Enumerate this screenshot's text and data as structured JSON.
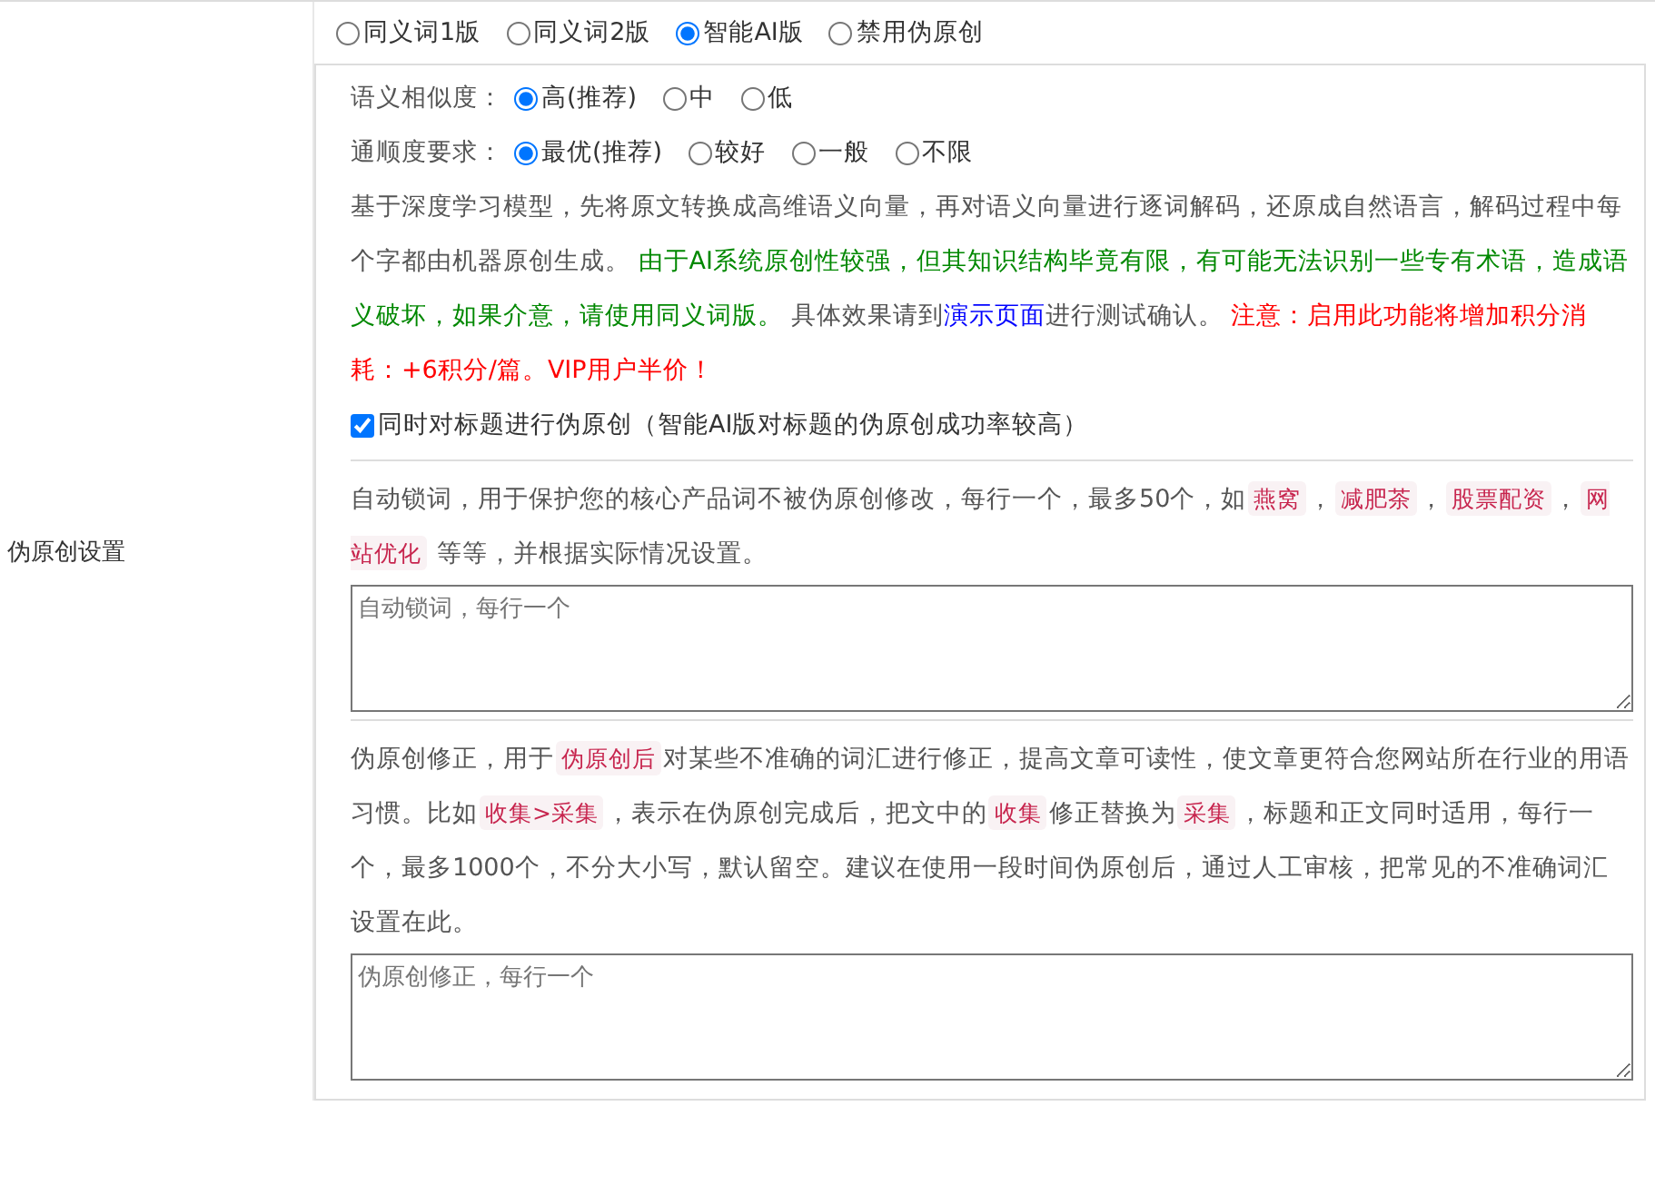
{
  "side_label": "伪原创设置",
  "modes": [
    {
      "label": "同义词1版",
      "selected": false
    },
    {
      "label": "同义词2版",
      "selected": false
    },
    {
      "label": "智能AI版",
      "selected": true
    },
    {
      "label": "禁用伪原创",
      "selected": false
    }
  ],
  "settings": [
    {
      "label": "语义相似度：",
      "options": [
        {
          "label": "高(推荐)",
          "selected": true
        },
        {
          "label": "中",
          "selected": false
        },
        {
          "label": "低",
          "selected": false
        }
      ]
    },
    {
      "label": "通顺度要求：",
      "options": [
        {
          "label": "最优(推荐)",
          "selected": true
        },
        {
          "label": "较好",
          "selected": false
        },
        {
          "label": "一般",
          "selected": false
        },
        {
          "label": "不限",
          "selected": false
        }
      ]
    }
  ],
  "ai_description": [
    {
      "kind": "text",
      "text": "基于深度学习模型，先将原文转换成高维语义向量，再对语义向量进行逐词解码，还原成自然语言，解码过程中每个字都由机器原创生成。 "
    },
    {
      "kind": "note",
      "text": "由于AI系统原创性较强，但其知识结构毕竟有限，有可能无法识别一些专有术语，造成语义破坏，如果介意，请使用同义词版。"
    },
    {
      "kind": "text",
      "text": " 具体效果请到"
    },
    {
      "kind": "link",
      "text": "演示页面"
    },
    {
      "kind": "text",
      "text": "进行测试确认。 "
    },
    {
      "kind": "warning",
      "text": "注意：启用此功能将增加积分消耗：+6积分/篇。VIP用户半价！"
    }
  ],
  "title_option": {
    "label": "同时对标题进行伪原创（智能AI版对标题的伪原创成功率较高）",
    "checked": true
  },
  "lock_words": {
    "description": [
      {
        "kind": "text",
        "text": "自动锁词，用于保护您的核心产品词不被伪原创修改，每行一个，最多50个，如"
      },
      {
        "kind": "code",
        "text": "燕窝"
      },
      {
        "kind": "text",
        "text": "，"
      },
      {
        "kind": "code",
        "text": "减肥茶"
      },
      {
        "kind": "text",
        "text": "，"
      },
      {
        "kind": "code",
        "text": "股票配资"
      },
      {
        "kind": "text",
        "text": "，"
      },
      {
        "kind": "code",
        "text": "网站优化"
      },
      {
        "kind": "text",
        "text": " 等等，并根据实际情况设置。"
      }
    ],
    "placeholder": "自动锁词，每行一个"
  },
  "corrections": {
    "description": [
      {
        "kind": "text",
        "text": "伪原创修正，用于"
      },
      {
        "kind": "code",
        "text": "伪原创后"
      },
      {
        "kind": "text",
        "text": "对某些不准确的词汇进行修正，提高文章可读性，使文章更符合您网站所在行业的用语习惯。比如"
      },
      {
        "kind": "code",
        "text": "收集>采集"
      },
      {
        "kind": "text",
        "text": "，表示在伪原创完成后，把文中的"
      },
      {
        "kind": "code",
        "text": "收集"
      },
      {
        "kind": "text",
        "text": "修正替换为"
      },
      {
        "kind": "code",
        "text": "采集"
      },
      {
        "kind": "text",
        "text": "，标题和正文同时适用，每行一个，最多1000个，不分大小写，默认留空。建议在使用一段时间伪原创后，通过人工审核，把常见的不准确词汇设置在此。"
      }
    ],
    "placeholder": "伪原创修正，每行一个"
  }
}
